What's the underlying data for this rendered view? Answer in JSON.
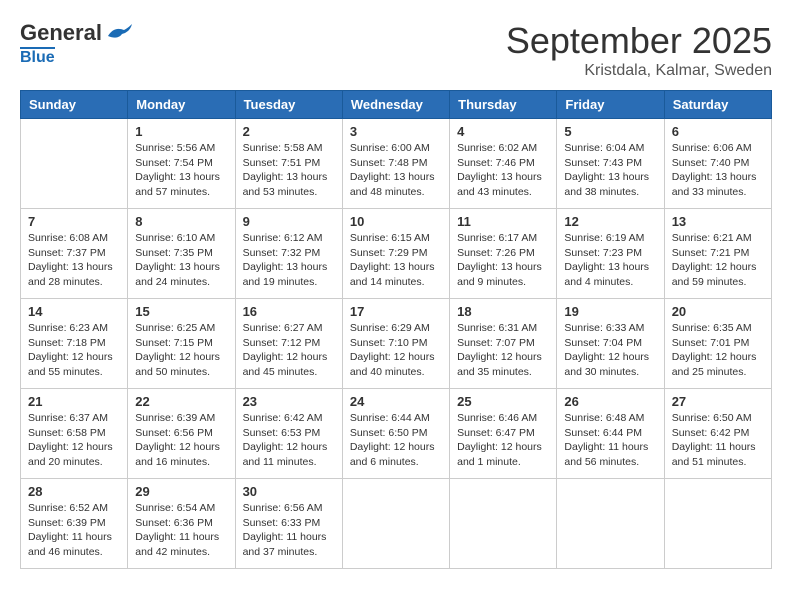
{
  "header": {
    "logo_general": "General",
    "logo_blue": "Blue",
    "month": "September 2025",
    "location": "Kristdala, Kalmar, Sweden"
  },
  "days_of_week": [
    "Sunday",
    "Monday",
    "Tuesday",
    "Wednesday",
    "Thursday",
    "Friday",
    "Saturday"
  ],
  "weeks": [
    [
      {
        "day": "",
        "info": ""
      },
      {
        "day": "1",
        "info": "Sunrise: 5:56 AM\nSunset: 7:54 PM\nDaylight: 13 hours\nand 57 minutes."
      },
      {
        "day": "2",
        "info": "Sunrise: 5:58 AM\nSunset: 7:51 PM\nDaylight: 13 hours\nand 53 minutes."
      },
      {
        "day": "3",
        "info": "Sunrise: 6:00 AM\nSunset: 7:48 PM\nDaylight: 13 hours\nand 48 minutes."
      },
      {
        "day": "4",
        "info": "Sunrise: 6:02 AM\nSunset: 7:46 PM\nDaylight: 13 hours\nand 43 minutes."
      },
      {
        "day": "5",
        "info": "Sunrise: 6:04 AM\nSunset: 7:43 PM\nDaylight: 13 hours\nand 38 minutes."
      },
      {
        "day": "6",
        "info": "Sunrise: 6:06 AM\nSunset: 7:40 PM\nDaylight: 13 hours\nand 33 minutes."
      }
    ],
    [
      {
        "day": "7",
        "info": "Sunrise: 6:08 AM\nSunset: 7:37 PM\nDaylight: 13 hours\nand 28 minutes."
      },
      {
        "day": "8",
        "info": "Sunrise: 6:10 AM\nSunset: 7:35 PM\nDaylight: 13 hours\nand 24 minutes."
      },
      {
        "day": "9",
        "info": "Sunrise: 6:12 AM\nSunset: 7:32 PM\nDaylight: 13 hours\nand 19 minutes."
      },
      {
        "day": "10",
        "info": "Sunrise: 6:15 AM\nSunset: 7:29 PM\nDaylight: 13 hours\nand 14 minutes."
      },
      {
        "day": "11",
        "info": "Sunrise: 6:17 AM\nSunset: 7:26 PM\nDaylight: 13 hours\nand 9 minutes."
      },
      {
        "day": "12",
        "info": "Sunrise: 6:19 AM\nSunset: 7:23 PM\nDaylight: 13 hours\nand 4 minutes."
      },
      {
        "day": "13",
        "info": "Sunrise: 6:21 AM\nSunset: 7:21 PM\nDaylight: 12 hours\nand 59 minutes."
      }
    ],
    [
      {
        "day": "14",
        "info": "Sunrise: 6:23 AM\nSunset: 7:18 PM\nDaylight: 12 hours\nand 55 minutes."
      },
      {
        "day": "15",
        "info": "Sunrise: 6:25 AM\nSunset: 7:15 PM\nDaylight: 12 hours\nand 50 minutes."
      },
      {
        "day": "16",
        "info": "Sunrise: 6:27 AM\nSunset: 7:12 PM\nDaylight: 12 hours\nand 45 minutes."
      },
      {
        "day": "17",
        "info": "Sunrise: 6:29 AM\nSunset: 7:10 PM\nDaylight: 12 hours\nand 40 minutes."
      },
      {
        "day": "18",
        "info": "Sunrise: 6:31 AM\nSunset: 7:07 PM\nDaylight: 12 hours\nand 35 minutes."
      },
      {
        "day": "19",
        "info": "Sunrise: 6:33 AM\nSunset: 7:04 PM\nDaylight: 12 hours\nand 30 minutes."
      },
      {
        "day": "20",
        "info": "Sunrise: 6:35 AM\nSunset: 7:01 PM\nDaylight: 12 hours\nand 25 minutes."
      }
    ],
    [
      {
        "day": "21",
        "info": "Sunrise: 6:37 AM\nSunset: 6:58 PM\nDaylight: 12 hours\nand 20 minutes."
      },
      {
        "day": "22",
        "info": "Sunrise: 6:39 AM\nSunset: 6:56 PM\nDaylight: 12 hours\nand 16 minutes."
      },
      {
        "day": "23",
        "info": "Sunrise: 6:42 AM\nSunset: 6:53 PM\nDaylight: 12 hours\nand 11 minutes."
      },
      {
        "day": "24",
        "info": "Sunrise: 6:44 AM\nSunset: 6:50 PM\nDaylight: 12 hours\nand 6 minutes."
      },
      {
        "day": "25",
        "info": "Sunrise: 6:46 AM\nSunset: 6:47 PM\nDaylight: 12 hours\nand 1 minute."
      },
      {
        "day": "26",
        "info": "Sunrise: 6:48 AM\nSunset: 6:44 PM\nDaylight: 11 hours\nand 56 minutes."
      },
      {
        "day": "27",
        "info": "Sunrise: 6:50 AM\nSunset: 6:42 PM\nDaylight: 11 hours\nand 51 minutes."
      }
    ],
    [
      {
        "day": "28",
        "info": "Sunrise: 6:52 AM\nSunset: 6:39 PM\nDaylight: 11 hours\nand 46 minutes."
      },
      {
        "day": "29",
        "info": "Sunrise: 6:54 AM\nSunset: 6:36 PM\nDaylight: 11 hours\nand 42 minutes."
      },
      {
        "day": "30",
        "info": "Sunrise: 6:56 AM\nSunset: 6:33 PM\nDaylight: 11 hours\nand 37 minutes."
      },
      {
        "day": "",
        "info": ""
      },
      {
        "day": "",
        "info": ""
      },
      {
        "day": "",
        "info": ""
      },
      {
        "day": "",
        "info": ""
      }
    ]
  ]
}
